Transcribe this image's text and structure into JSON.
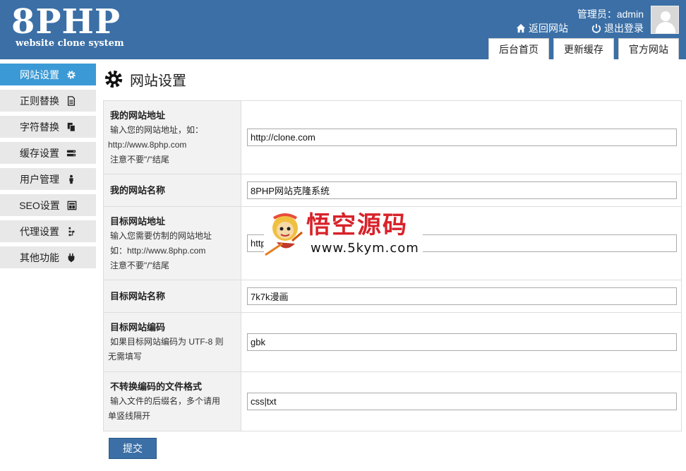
{
  "header": {
    "logo_main": "8PHP",
    "logo_sub": "website clone system",
    "admin_label": "管理员：admin",
    "back_site": "返回网站",
    "logout": "退出登录",
    "tabs": [
      "后台首页",
      "更新缓存",
      "官方网站"
    ],
    "bg_color": "#3b6fa6"
  },
  "sidebar": {
    "items": [
      {
        "label": "网站设置",
        "icon": "gear-icon",
        "active": true
      },
      {
        "label": "正则替换",
        "icon": "document-icon"
      },
      {
        "label": "字符替换",
        "icon": "copy-icon"
      },
      {
        "label": "缓存设置",
        "icon": "database-icon"
      },
      {
        "label": "用户管理",
        "icon": "user-icon"
      },
      {
        "label": "SEO设置",
        "icon": "layout-icon"
      },
      {
        "label": "代理设置",
        "icon": "sitemap-icon"
      },
      {
        "label": "其他功能",
        "icon": "plug-icon"
      }
    ],
    "active_color": "#3b9ad6"
  },
  "main": {
    "title": "网站设置",
    "rows": [
      {
        "label": "我的网站地址",
        "hint_lines": [
          "输入您的网站地址，如：",
          "http://www.8php.com",
          "注意不要\"/\"结尾"
        ],
        "value": "http://clone.com"
      },
      {
        "label": "我的网站名称",
        "hint_lines": [],
        "value": "8PHP网站克隆系统"
      },
      {
        "label": "目标网站地址",
        "hint_lines": [
          "输入您需要仿制的网站地址",
          "如：http://www.8php.com",
          "注意不要\"/\"结尾"
        ],
        "value": "http"
      },
      {
        "label": "目标网站名称",
        "hint_lines": [],
        "value": "7k7k漫画"
      },
      {
        "label": "目标网站编码",
        "hint_lines": [
          "如果目标网站编码为 UTF-8 则",
          "无需填写"
        ],
        "value": "gbk"
      },
      {
        "label": "不转换编码的文件格式",
        "hint_lines": [
          "输入文件的后缀名，多个请用",
          "单竖线隔开"
        ],
        "value": "css|txt"
      }
    ],
    "submit_label": "提交"
  },
  "watermark": {
    "title": "悟空源码",
    "url": "www.5kym.com"
  }
}
